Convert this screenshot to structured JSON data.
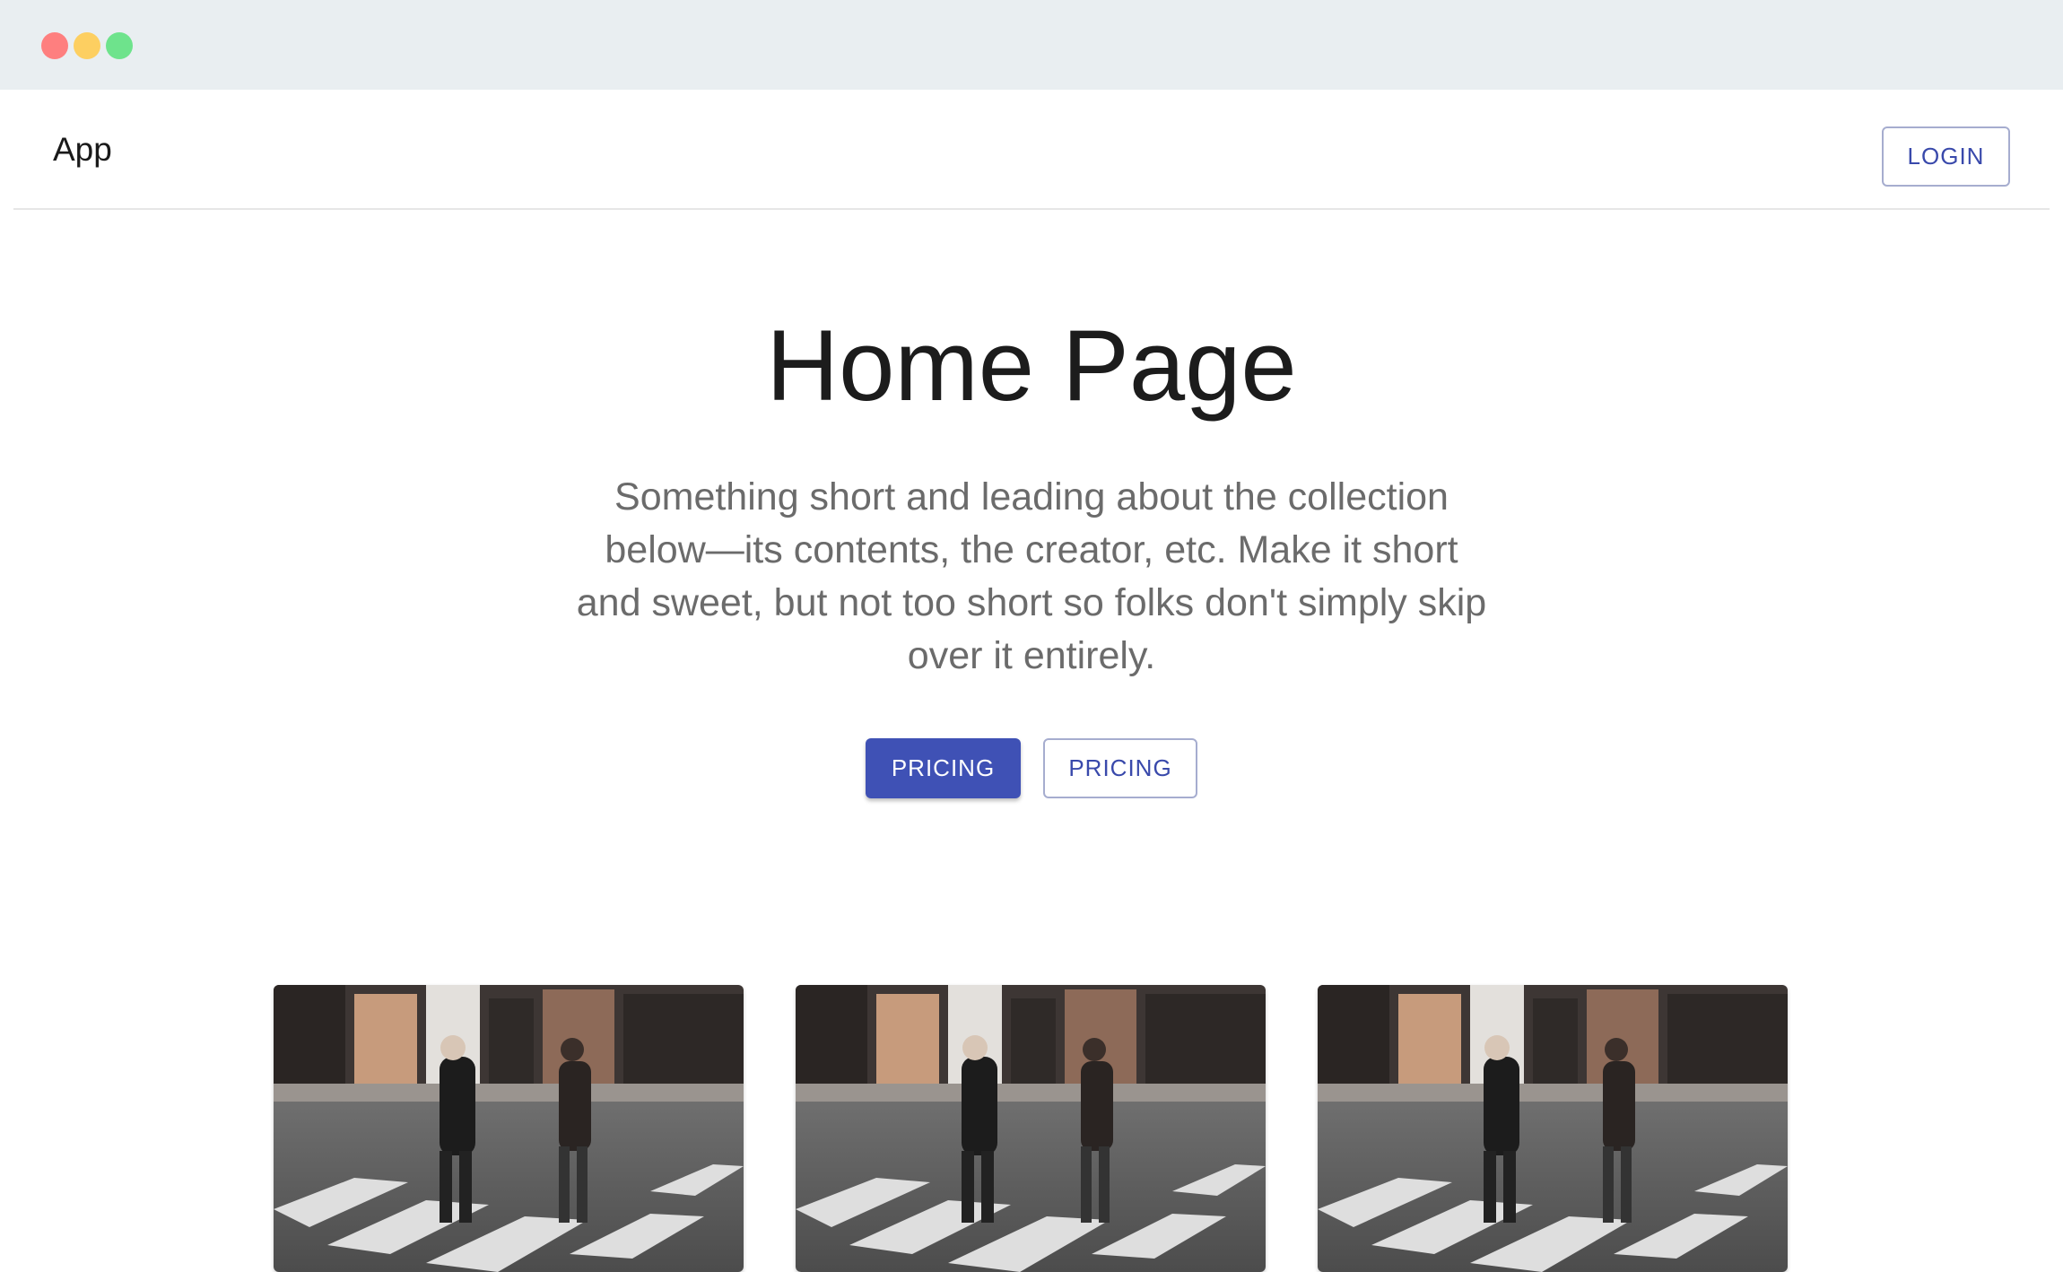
{
  "window": {
    "controls": [
      "close",
      "minimize",
      "maximize"
    ]
  },
  "header": {
    "app_title": "App",
    "login_label": "LOGIN"
  },
  "hero": {
    "title": "Home Page",
    "description": "Something short and leading about the collection below—its contents, the creator, etc. Make it short and sweet, but not too short so folks don't simply skip over it entirely.",
    "primary_button": "PRICING",
    "secondary_button": "PRICING"
  },
  "cards": [
    {
      "image": "street-crosswalk-photo"
    },
    {
      "image": "street-crosswalk-photo"
    },
    {
      "image": "street-crosswalk-photo"
    }
  ],
  "colors": {
    "primary": "#3f51b5",
    "chrome": "#e9eef1",
    "text_secondary": "#6b6b6b"
  }
}
